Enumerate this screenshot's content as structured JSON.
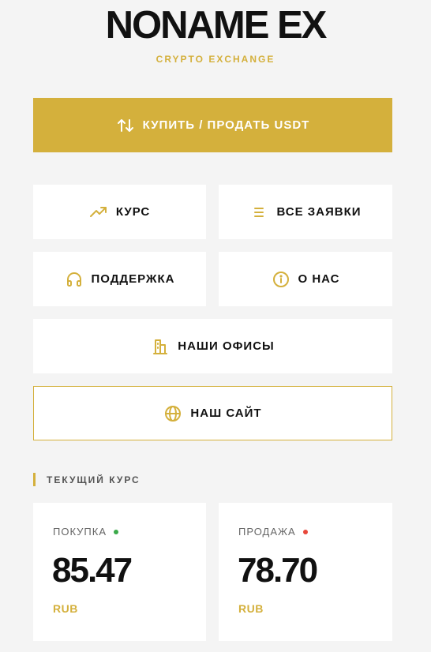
{
  "brand": {
    "title": "NONAME EX",
    "tagline": "CRYPTO EXCHANGE"
  },
  "colors": {
    "accent": "#d4b03c",
    "background": "#f4f4f4",
    "buy_dot": "#3aaa4a",
    "sell_dot": "#e8473a"
  },
  "menu": {
    "primary": {
      "label": "КУПИТЬ / ПРОДАТЬ USDT",
      "icon": "arrows-swap-icon"
    },
    "rate": {
      "label": "КУРС",
      "icon": "trend-up-icon"
    },
    "orders": {
      "label": "ВСЕ ЗАЯВКИ",
      "icon": "list-icon"
    },
    "support": {
      "label": "ПОДДЕРЖКА",
      "icon": "headphones-icon"
    },
    "about": {
      "label": "О НАС",
      "icon": "info-icon"
    },
    "offices": {
      "label": "НАШИ ОФИСЫ",
      "icon": "building-icon"
    },
    "site": {
      "label": "НАШ САЙТ",
      "icon": "globe-icon"
    }
  },
  "rates": {
    "section_title": "ТЕКУЩИЙ КУРС",
    "buy": {
      "label": "ПОКУПКА",
      "value": "85.47",
      "currency": "RUB"
    },
    "sell": {
      "label": "ПРОДАЖА",
      "value": "78.70",
      "currency": "RUB"
    }
  }
}
